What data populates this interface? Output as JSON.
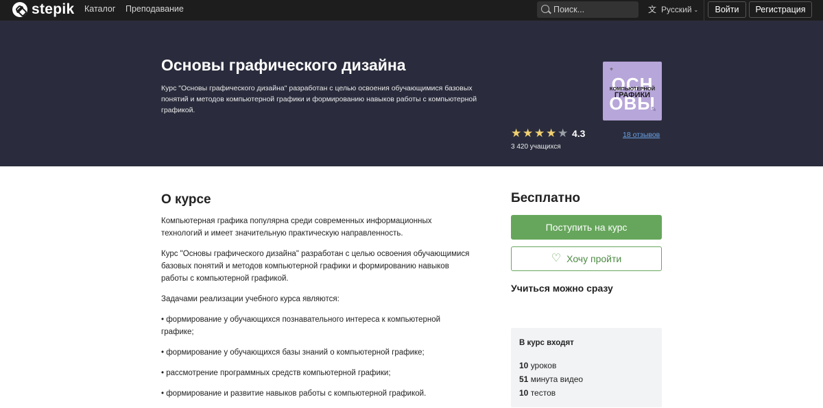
{
  "navbar": {
    "logo_text": "stepik",
    "links": [
      "Каталог",
      "Преподавание"
    ],
    "search_placeholder": "Поиск...",
    "language": "Русский",
    "login_label": "Войти",
    "register_label": "Регистрация"
  },
  "hero": {
    "title": "Основы графического дизайна",
    "description": "Курс \"Основы графического дизайна\" разработан с целью освоения обучающимися базовых понятий и методов компьютерной графики и формированию навыков работы с компьютерной графикой.",
    "cover": {
      "big_top": "ОСН",
      "small_line1": "КОМПЬЮТЕРНОЙ",
      "small_line2": "ГРАФИКИ",
      "big_bottom": "ОВЫ"
    },
    "rating": "4.3",
    "stars_filled": 4,
    "stars_total": 5,
    "reviews": "18 отзывов",
    "students": "3 420 учащихся"
  },
  "about": {
    "title": "О курсе",
    "paragraphs": [
      "Компьютерная графика популярна среди современных информационных технологий и имеет значительную практическую направленность.",
      "Курс \"Основы графического дизайна\" разработан с целью освоения обучающимися базовых понятий и методов компьютерной графики и формированию навыков работы с компьютерной графикой.",
      "Задачами реализации учебного курса являются:",
      "• формирование у обучающихся познавательного интереса к компьютерной графике;",
      "• формирование у обучающихся базы знаний о компьютерной графике;",
      "• рассмотрение программных средств компьютерной графики;",
      "• формирование и развитие навыков работы с компьютерной графикой."
    ]
  },
  "sidebar": {
    "price": "Бесплатно",
    "enroll_label": "Поступить на курс",
    "wishlist_label": "Хочу пройти",
    "study_now": "Учиться можно сразу",
    "includes_title": "В курс входят",
    "includes": [
      {
        "num": "10",
        "text": " уроков"
      },
      {
        "num": "51",
        "text": " минута видео"
      },
      {
        "num": "10",
        "text": " тестов"
      }
    ]
  },
  "colors": {
    "navbar_bg": "#1d1d1d",
    "hero_bg": "#2a2c3d",
    "accent_green": "#66a65c",
    "link_blue": "#6aa2e6",
    "star_gold": "#f0d070",
    "cover_purple": "#b7a6d9"
  }
}
